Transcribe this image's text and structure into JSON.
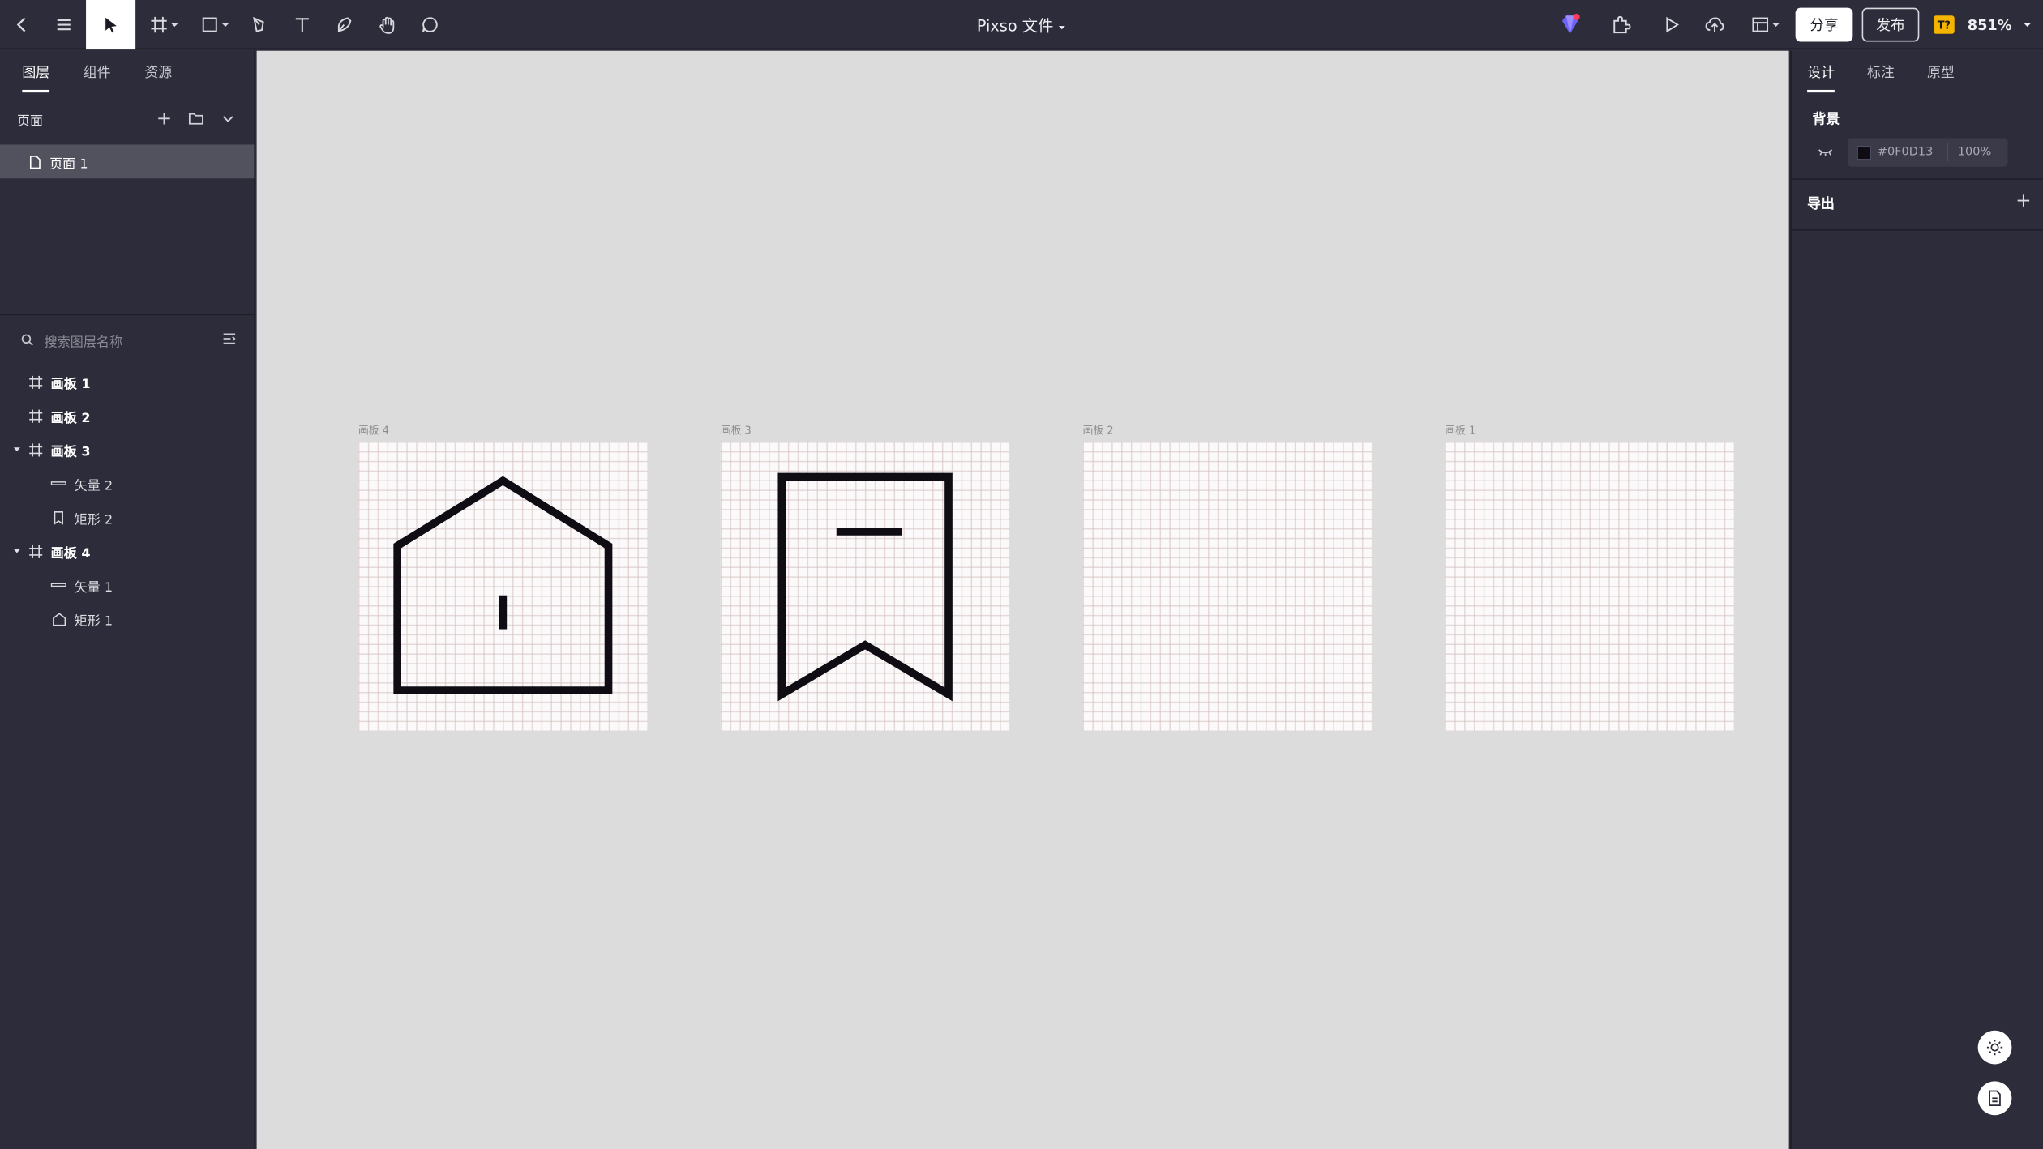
{
  "app": {
    "doc_title": "Pixso 文件",
    "share_label": "分享",
    "publish_label": "发布",
    "font_badge": "T?",
    "zoom": "851%"
  },
  "toolbar": {
    "icons": [
      "back-icon",
      "menu-icon",
      "move-tool-icon",
      "frame-tool-icon",
      "shape-tool-icon",
      "pen-tool-icon",
      "text-tool-icon",
      "pencil-tool-icon",
      "hand-tool-icon",
      "comment-tool-icon"
    ],
    "active_tool": "move-tool-icon"
  },
  "left_panel": {
    "tabs": [
      {
        "label": "图层",
        "active": true
      },
      {
        "label": "组件",
        "active": false
      },
      {
        "label": "资源",
        "active": false
      }
    ],
    "pages_header": "页面",
    "pages": [
      {
        "label": "页面 1",
        "selected": true
      }
    ],
    "search_placeholder": "搜索图层名称",
    "layers": [
      {
        "label": "画板 1",
        "level": 0,
        "icon": "frame-icon",
        "expanded": false
      },
      {
        "label": "画板 2",
        "level": 0,
        "icon": "frame-icon",
        "expanded": false
      },
      {
        "label": "画板 3",
        "level": 0,
        "icon": "frame-icon",
        "expanded": true
      },
      {
        "label": "矢量 2",
        "level": 1,
        "icon": "vector-line-icon"
      },
      {
        "label": "矩形 2",
        "level": 1,
        "icon": "bookmark-shape-icon"
      },
      {
        "label": "画板 4",
        "level": 0,
        "icon": "frame-icon",
        "expanded": true
      },
      {
        "label": "矢量 1",
        "level": 1,
        "icon": "vector-line-icon"
      },
      {
        "label": "矩形 1",
        "level": 1,
        "icon": "house-shape-icon"
      }
    ]
  },
  "canvas": {
    "background": "#dcdcdc",
    "boards": [
      {
        "label": "画板 4",
        "content": "house-icon"
      },
      {
        "label": "画板 3",
        "content": "bookmark-icon"
      },
      {
        "label": "画板 2",
        "content": ""
      },
      {
        "label": "画板 1",
        "content": ""
      }
    ]
  },
  "right_panel": {
    "tabs": [
      {
        "label": "设计",
        "active": true
      },
      {
        "label": "标注",
        "active": false
      },
      {
        "label": "原型",
        "active": false
      }
    ],
    "background_title": "背景",
    "background_color": "#0F0D13",
    "background_opacity": "100%",
    "export_title": "导出"
  }
}
